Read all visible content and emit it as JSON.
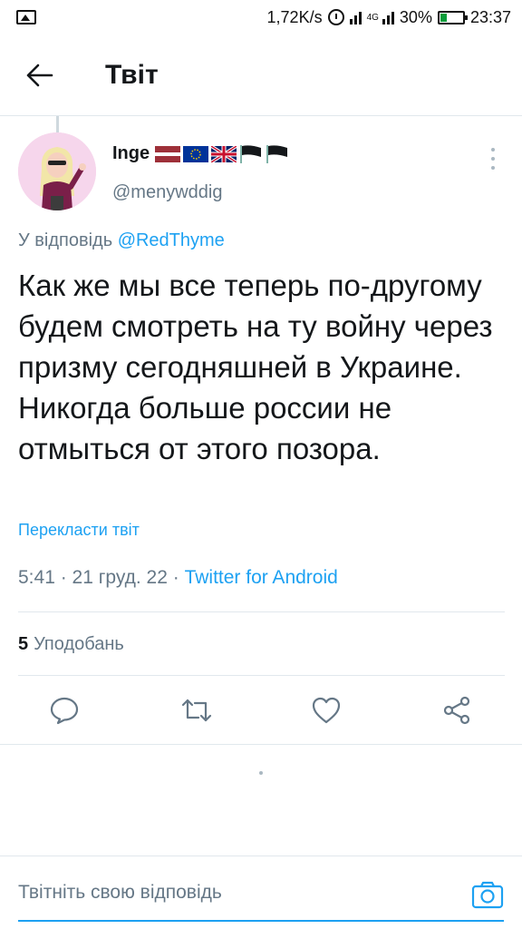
{
  "status_bar": {
    "speed": "1,72K/s",
    "network_type": "4G",
    "battery": "30%",
    "battery_level": 0.3,
    "time": "23:37"
  },
  "header": {
    "title": "Твіт",
    "back_icon": "arrow-left-icon"
  },
  "tweet": {
    "author_name": "Inge",
    "author_flags": [
      "latvia-flag",
      "eu-flag",
      "uk-flag",
      "black-flag",
      "black-flag"
    ],
    "author_handle": "@menywddig",
    "reply_prefix": "У відповідь",
    "reply_mention": "@RedThyme",
    "text": "Как же мы все теперь по-другому будем смотреть на ту войну через призму сегодняшней в Украине. Никогда больше россии не отмыться от этого позора.",
    "translate_label": "Перекласти твіт",
    "timestamp": "5:41 · 21 груд. 22 · ",
    "source": "Twitter for Android",
    "likes_count": "5",
    "likes_label": "Уподобань"
  },
  "actions": {
    "reply_icon": "comment-icon",
    "retweet_icon": "retweet-icon",
    "like_icon": "heart-icon",
    "share_icon": "share-icon"
  },
  "compose": {
    "placeholder": "Твітніть свою відповідь",
    "camera_icon": "camera-icon"
  },
  "colors": {
    "accent": "#1da1f2",
    "secondary_text": "#657786",
    "divider": "#e1e8ed"
  }
}
